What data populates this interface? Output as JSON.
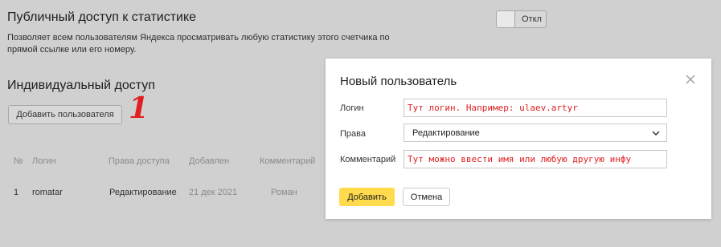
{
  "public_access": {
    "title": "Публичный доступ к статистике",
    "description": "Позволяет всем пользователям Яндекса просматривать любую статистику этого счетчика по прямой ссылке или его номеру.",
    "toggle_label": "Откл"
  },
  "individual_access": {
    "title": "Индивидуальный доступ",
    "add_user_label": "Добавить пользователя",
    "annotation": "1"
  },
  "table": {
    "headers": {
      "num": "№",
      "login": "Логин",
      "rights": "Права доступа",
      "added": "Добавлен",
      "comment": "Комментарий"
    },
    "rows": [
      {
        "num": "1",
        "login": "romatar",
        "rights": "Редактирование",
        "added": "21 дек 2021",
        "comment": "Роман"
      }
    ]
  },
  "modal": {
    "title": "Новый пользователь",
    "login_label": "Логин",
    "login_value": "Тут логин. Например: ulaev.artyr",
    "rights_label": "Права",
    "rights_value": "Редактирование",
    "comment_label": "Комментарий",
    "comment_value": "Тут можно ввести имя или любую другую инфу",
    "add_button": "Добавить",
    "cancel_button": "Отмена"
  },
  "colors": {
    "overlay_bg": "#d0d0d0",
    "accent_yellow": "#ffdb4d",
    "annotation_red": "#e02020"
  },
  "icons": {
    "close": "close-icon",
    "dropdown": "chevron-down-icon"
  }
}
